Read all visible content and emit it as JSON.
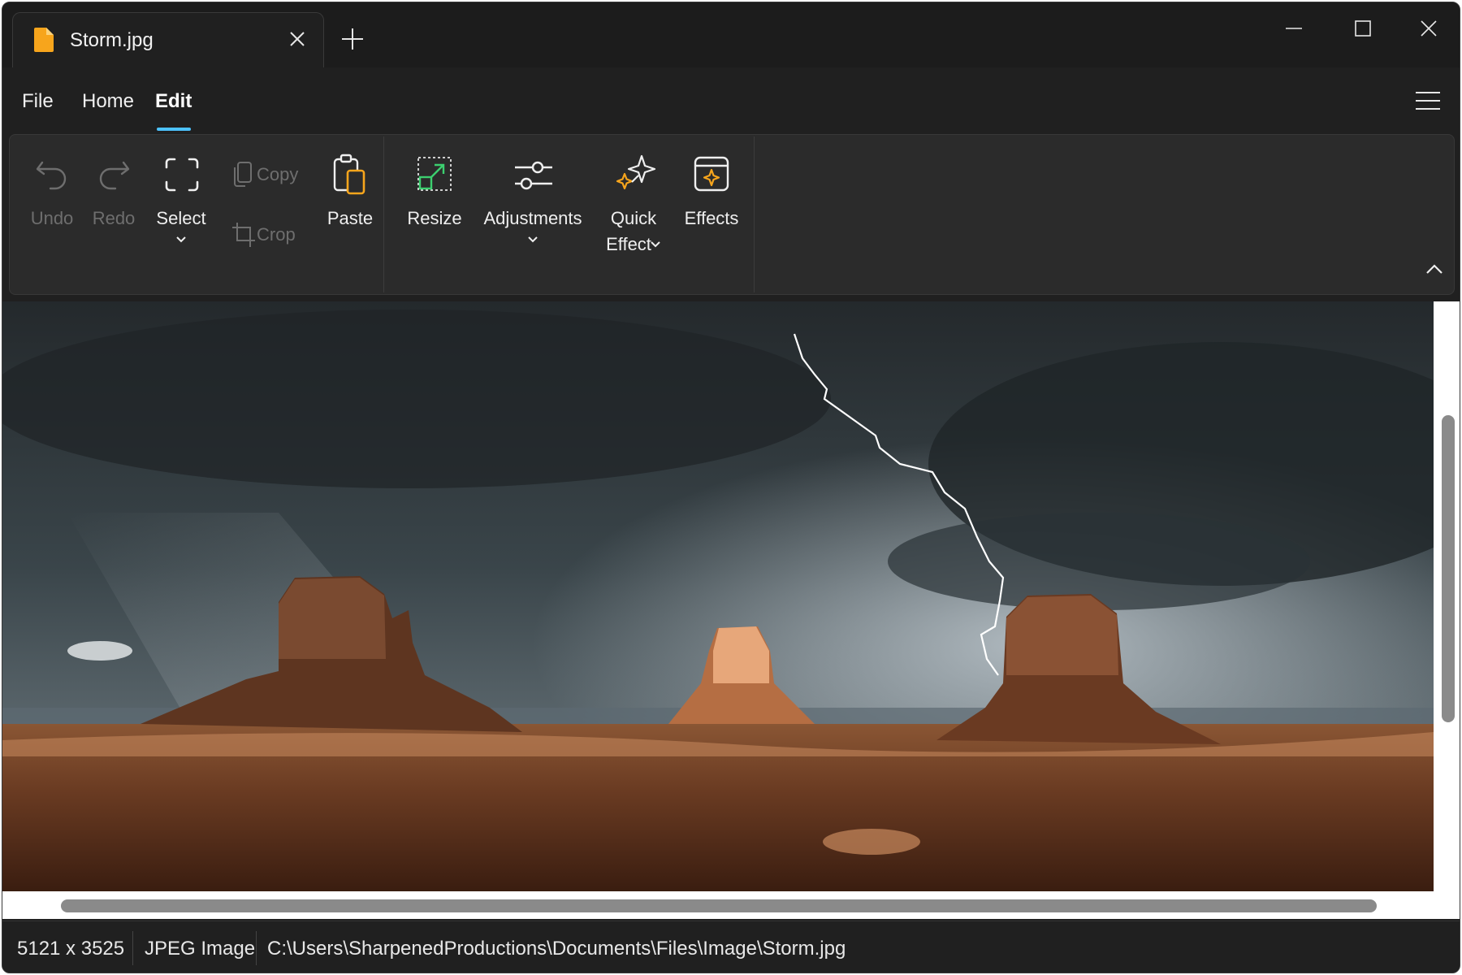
{
  "tab": {
    "title": "Storm.jpg",
    "icon": "file-document-icon",
    "icon_color": "#f7a51c"
  },
  "window_controls": [
    "minimize",
    "maximize",
    "close"
  ],
  "menu": {
    "items": [
      "File",
      "Home",
      "Edit"
    ],
    "active": "Edit",
    "accent_color": "#4cc2ff"
  },
  "ribbon": {
    "tools": {
      "undo": {
        "label": "Undo",
        "enabled": false,
        "icon": "undo-icon"
      },
      "redo": {
        "label": "Redo",
        "enabled": false,
        "icon": "redo-icon"
      },
      "select": {
        "label": "Select",
        "enabled": true,
        "icon": "select-frame-icon",
        "has_dropdown": true
      },
      "copy": {
        "label": "Copy",
        "enabled": false,
        "icon": "copy-icon"
      },
      "crop": {
        "label": "Crop",
        "enabled": false,
        "icon": "crop-icon"
      },
      "paste": {
        "label": "Paste",
        "enabled": true,
        "icon": "paste-icon"
      },
      "resize": {
        "label": "Resize",
        "enabled": true,
        "icon": "resize-icon"
      },
      "adjustments": {
        "label": "Adjustments",
        "enabled": true,
        "icon": "sliders-icon",
        "has_dropdown": true
      },
      "quick_effect": {
        "label_line1": "Quick",
        "label_line2": "Effect",
        "enabled": true,
        "icon": "sparkle-icon",
        "has_dropdown": true
      },
      "effects": {
        "label": "Effects",
        "enabled": true,
        "icon": "effects-icon"
      }
    }
  },
  "image": {
    "description_icon": "storm-landscape-photo"
  },
  "status": {
    "dimensions": "5121 x 3525",
    "type": "JPEG Image",
    "path": "C:\\Users\\SharpenedProductions\\Documents\\Files\\Image\\Storm.jpg"
  }
}
